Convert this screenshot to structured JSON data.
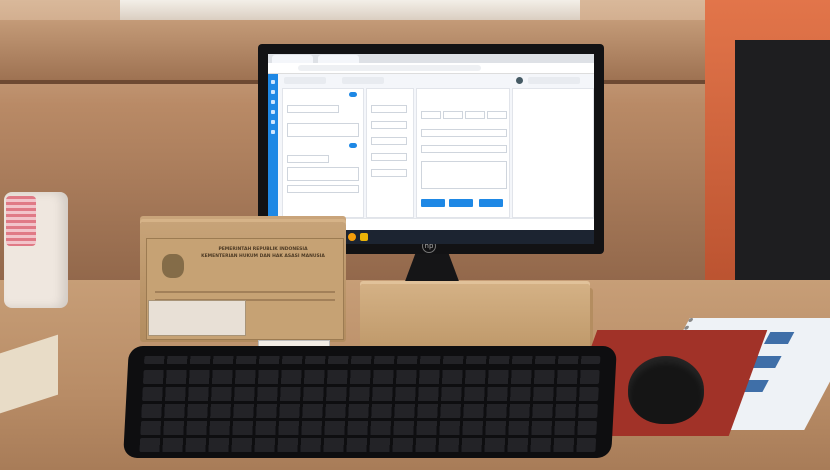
{
  "scene": {
    "kind": "photo-of-desk-with-computer",
    "colors": {
      "wall": "#b98a66",
      "orange_wall": "#d9683f",
      "desk": "#c29770",
      "screen_accent": "#1e88e5",
      "mousepad": "#a13228"
    }
  },
  "screen": {
    "browser": {
      "tabs": [
        "",
        ""
      ],
      "url": ""
    },
    "app": {
      "toolbar_fields": [
        "",
        ""
      ],
      "panels": {
        "left": {
          "labels": [
            "",
            "",
            "",
            "",
            "",
            ""
          ]
        },
        "middle": {
          "labels": [
            "",
            "",
            "",
            "",
            ""
          ]
        },
        "right": {
          "labels": [
            "",
            "",
            "",
            "",
            ""
          ]
        },
        "far_right": {
          "label": ""
        }
      },
      "buttons": [
        "",
        "",
        ""
      ]
    },
    "taskbar": {
      "icons": [
        "windows-icon",
        "search-icon",
        "chrome-icon",
        "explorer-icon"
      ],
      "clock": ""
    }
  },
  "envelope": {
    "text_lines": [
      "PEMERINTAH REPUBLIK INDONESIA",
      "KEMENTERIAN HUKUM DAN HAK ASASI MANUSIA"
    ]
  },
  "icons": {
    "hp_logo": "hp-logo-icon",
    "emblem": "garuda-emblem-icon"
  }
}
